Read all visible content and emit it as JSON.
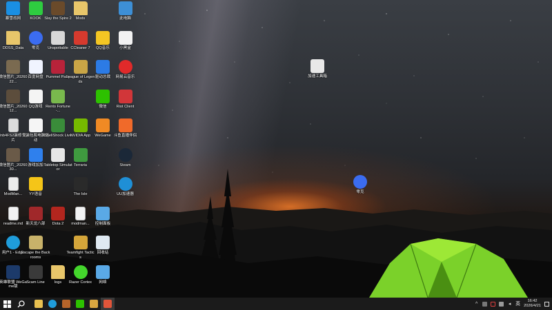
{
  "desktop": {
    "icons": [
      {
        "label": "暴雪战网",
        "icon": "battlenet-icon",
        "color": "#1a8fe3"
      },
      {
        "label": "KOOK",
        "icon": "kook-icon",
        "color": "#2ecc40"
      },
      {
        "label": "Slay the Spire 2",
        "icon": "slay-the-spire-icon",
        "color": "#6a4a2a"
      },
      {
        "label": "Mods",
        "icon": "folder-icon",
        "color": "#e8c66a"
      },
      {
        "label": "此电脑",
        "icon": "this-pc-icon",
        "color": "#3d8fd6"
      },
      {
        "label": "DDSS_Data",
        "icon": "folder-icon",
        "color": "#e8c66a"
      },
      {
        "label": "零克",
        "icon": "lingke-icon",
        "color": "#3b6cf0"
      },
      {
        "label": "Unspottable",
        "icon": "unspottable-icon",
        "color": "#d8d8d8"
      },
      {
        "label": "CCleaner 7",
        "icon": "ccleaner-icon",
        "color": "#d63a2e"
      },
      {
        "label": "QQ音乐",
        "icon": "qq-music-icon",
        "color": "#f3c623"
      },
      {
        "label": "小黑盒",
        "icon": "xiaoheihe-icon",
        "color": "#f2f2f2"
      },
      {
        "label": "微信图片_2026022...",
        "icon": "image-file-icon",
        "color": "#7a6a50"
      },
      {
        "label": "百度网盘",
        "icon": "baidu-netdisk-icon",
        "color": "#f0f4ff"
      },
      {
        "label": "Pummel Party",
        "icon": "pummel-party-icon",
        "color": "#b8233a"
      },
      {
        "label": "League of Legends",
        "icon": "league-icon",
        "color": "#c9a546"
      },
      {
        "label": "驱动总裁",
        "icon": "driver-icon",
        "color": "#2c7be5"
      },
      {
        "label": "网易云音乐",
        "icon": "netease-music-icon",
        "color": "#e02a2a"
      },
      {
        "label": "微信图片_2026012...",
        "icon": "image-file-icon",
        "color": "#5c4d3c"
      },
      {
        "label": "QQ游戏",
        "icon": "qq-game-icon",
        "color": "#f4f4f4"
      },
      {
        "label": "Rento Fortune -...",
        "icon": "rento-fortune-icon",
        "color": "#79b94d"
      },
      {
        "label": "微信",
        "icon": "wechat-icon",
        "color": "#2dc100"
      },
      {
        "label": "Riot Client",
        "icon": "riot-client-icon",
        "color": "#d13639"
      },
      {
        "label": "Inb4FS2装修 贴片",
        "icon": "file-icon",
        "color": "#dcdcdc"
      },
      {
        "label": "安装包和电脑驱 动",
        "icon": "archive-icon",
        "color": "#f5f5f5"
      },
      {
        "label": "ShellShock Live",
        "icon": "shellshock-icon",
        "color": "#3a8c3a"
      },
      {
        "label": "NVIDIA App",
        "icon": "nvidia-icon",
        "color": "#76b900"
      },
      {
        "label": "WeGame",
        "icon": "wegame-icon",
        "color": "#f08a24"
      },
      {
        "label": "斗鱼直播伴侣",
        "icon": "douyu-icon",
        "color": "#f06a2a"
      },
      {
        "label": "微信图片_2026030...",
        "icon": "image-file-icon",
        "color": "#6a5a48"
      },
      {
        "label": "游戏加加",
        "icon": "youxijiajia-icon",
        "color": "#2f80ed"
      },
      {
        "label": "Tabletop Simulator",
        "icon": "tabletop-icon",
        "color": "#e6e6e6"
      },
      {
        "label": "Terraria",
        "icon": "terraria-icon",
        "color": "#3f9a3f"
      },
      {
        "label": "Steam",
        "icon": "steam-icon",
        "color": "#1b2838"
      },
      {
        "label": "ModMan...",
        "icon": "modman-file-icon",
        "color": "#ececec"
      },
      {
        "label": "YY语音",
        "icon": "yy-icon",
        "color": "#f5c518"
      },
      {
        "label": "The Isle",
        "icon": "the-isle-icon",
        "color": "#2a2a2a"
      },
      {
        "label": "UU加速器",
        "icon": "uu-icon",
        "color": "#1f8fd6"
      },
      {
        "label": "readme.md",
        "icon": "text-file-icon",
        "color": "#f2f2f2"
      },
      {
        "label": "新天龙八部",
        "icon": "tlbb-icon",
        "color": "#a0282a"
      },
      {
        "label": "Dota 2",
        "icon": "dota2-icon",
        "color": "#b3261e"
      },
      {
        "label": "modman...",
        "icon": "text-file-icon",
        "color": "#f2f2f2"
      },
      {
        "label": "控制面板",
        "icon": "control-panel-icon",
        "color": "#5aa9e6"
      },
      {
        "label": "用户1 - Edge",
        "icon": "edge-icon",
        "color": "#1f9ddb"
      },
      {
        "label": "Escape the Backrooms",
        "icon": "backrooms-icon",
        "color": "#c8b26a"
      },
      {
        "label": "Teamfight Tactics",
        "icon": "tft-icon",
        "color": "#d4a53a"
      },
      {
        "label": "回收站",
        "icon": "recycle-bin-icon",
        "color": "#dfe9f2"
      },
      {
        "label": "英雄联盟 WeGame版",
        "icon": "lol-wegame-icon",
        "color": "#1c3a6a"
      },
      {
        "label": "Scam Line",
        "icon": "scam-line-icon",
        "color": "#3a3a3a"
      },
      {
        "label": "logs",
        "icon": "folder-icon",
        "color": "#e8c66a"
      },
      {
        "label": "Razer Cortex",
        "icon": "razer-cortex-icon",
        "color": "#44d62c"
      },
      {
        "label": "网络",
        "icon": "network-icon",
        "color": "#5aa9e6"
      },
      {
        "label": "加速工具箱",
        "icon": "x-launcher-icon",
        "color": "#e8e8e8"
      },
      {
        "label": "零克",
        "icon": "lingke-icon",
        "color": "#3b6cf0"
      }
    ]
  },
  "taskbar": {
    "start": "windows-icon",
    "search": "search-icon",
    "apps": [
      "file-explorer-icon",
      "edge-icon",
      "game-icon",
      "wechat-icon",
      "folder-icon",
      "app-icon"
    ],
    "tray": {
      "time": "16:42",
      "date": "2026/4/21"
    }
  }
}
